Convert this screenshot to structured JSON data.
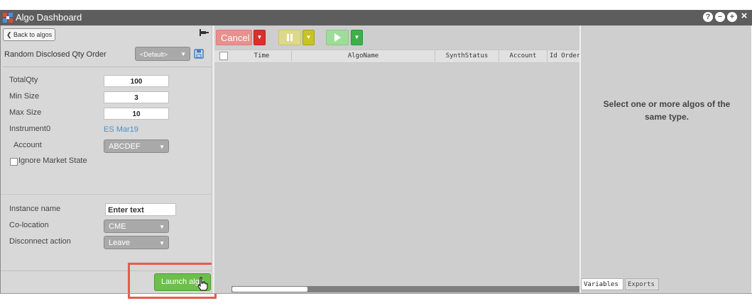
{
  "window": {
    "title": "Algo Dashboard",
    "controls": [
      "?",
      "−",
      "+",
      "×"
    ]
  },
  "left_panel": {
    "back_label": "Back to algos",
    "algo_name": "Random Disclosed Qty Order",
    "profile_value": "<Default>",
    "params": {
      "total_qty": {
        "label": "TotalQty",
        "value": "100"
      },
      "min_size": {
        "label": "Min Size",
        "value": "3"
      },
      "max_size": {
        "label": "Max Size",
        "value": "10"
      },
      "instrument": {
        "label": "Instrument0",
        "value": "ES Mar19"
      },
      "account": {
        "label": "Account",
        "value": "ABCDEF"
      },
      "ignore_market_state": {
        "label": "Ignore Market State",
        "checked": false
      }
    },
    "instance_name": {
      "label": "Instance name",
      "placeholder": "Enter text"
    },
    "colocation": {
      "label": "Co-location",
      "value": "CME"
    },
    "disconnect_action": {
      "label": "Disconnect action",
      "value": "Leave"
    },
    "launch_label": "Launch algo"
  },
  "toolbar": {
    "cancel_label": "Cancel",
    "colors": {
      "cancel": "#e8908d",
      "pause": "#dcd98c",
      "play": "#9fdc9a"
    }
  },
  "grid": {
    "columns": [
      "Time",
      "AlgoName",
      "SynthStatus",
      "Account",
      "Id Order"
    ]
  },
  "right_panel": {
    "message": "Select one or more algos of the same type.",
    "tabs": [
      "Variables",
      "Exports"
    ]
  }
}
